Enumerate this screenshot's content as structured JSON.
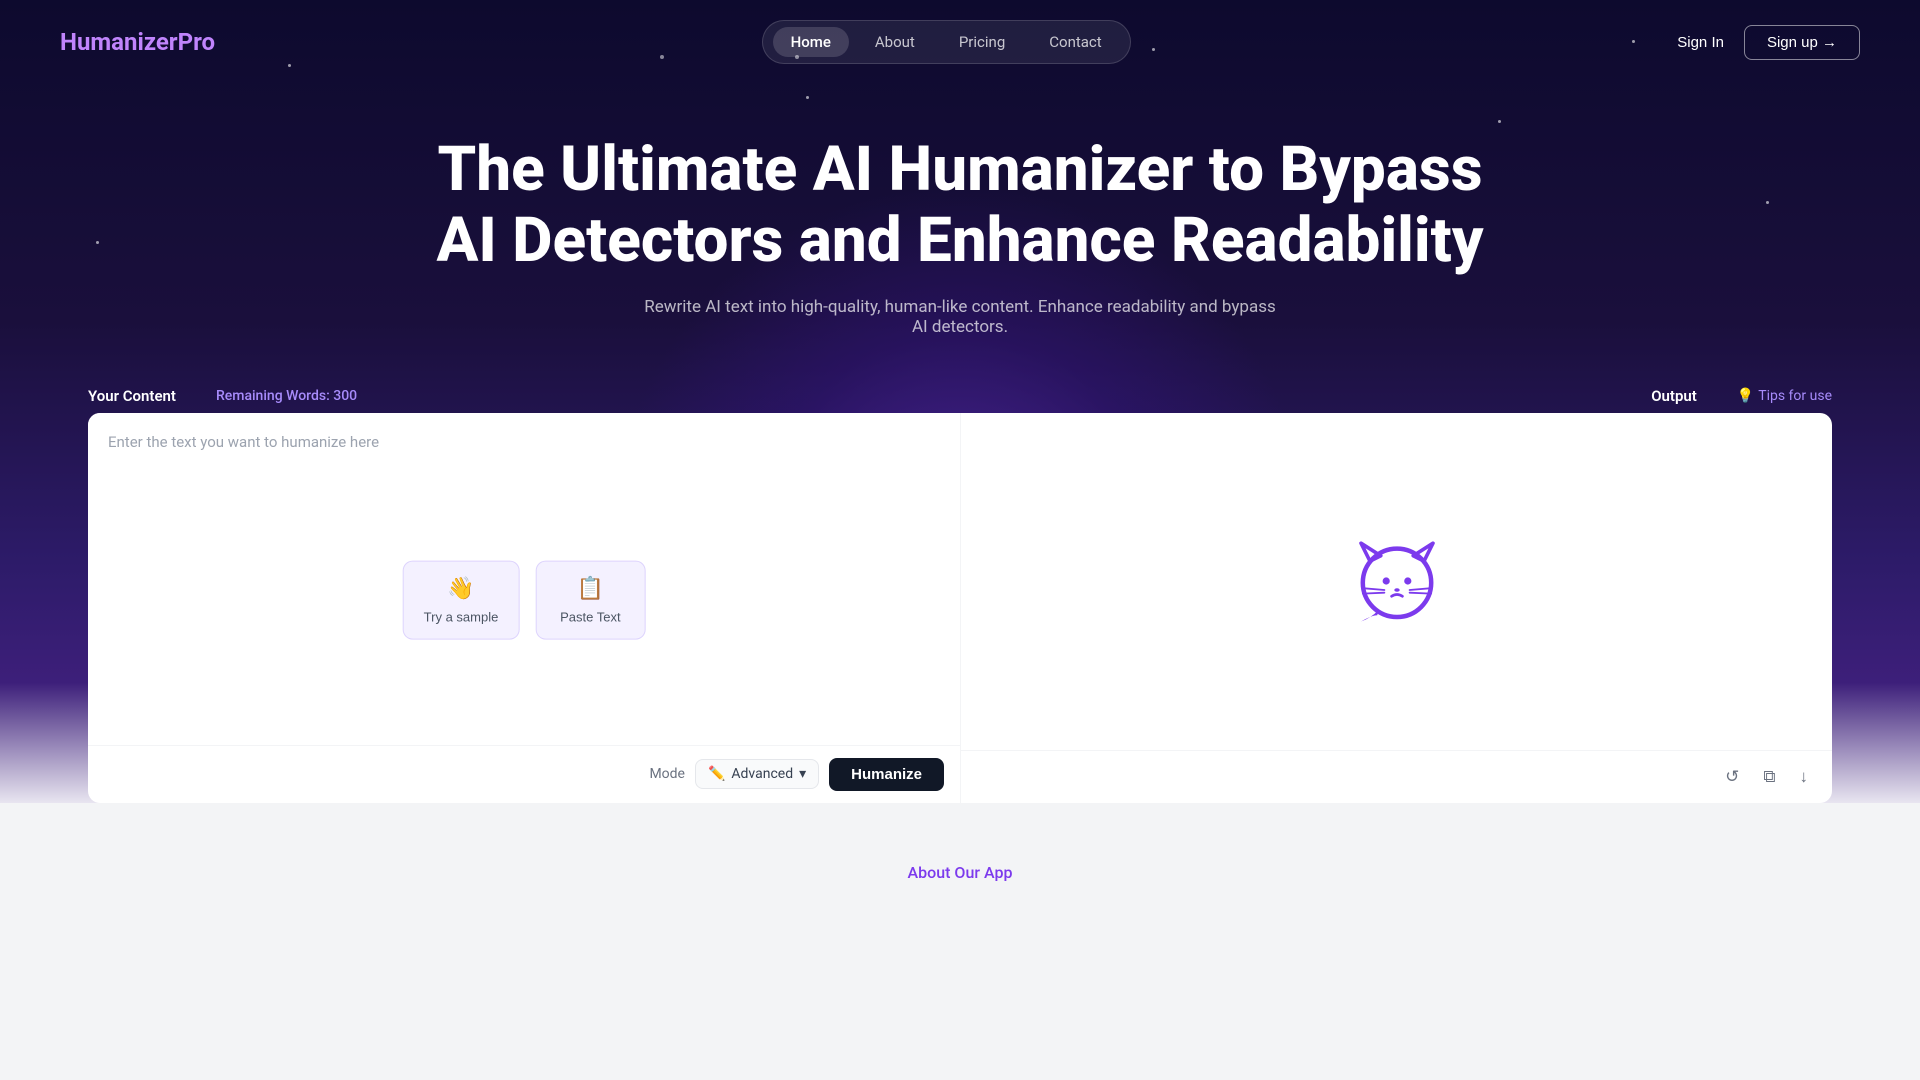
{
  "brand": {
    "name_black": "Humanizer",
    "name_purple": "Pro"
  },
  "nav": {
    "links": [
      {
        "label": "Home",
        "active": true
      },
      {
        "label": "About",
        "active": false
      },
      {
        "label": "Pricing",
        "active": false
      },
      {
        "label": "Contact",
        "active": false
      }
    ],
    "sign_in": "Sign In",
    "sign_up": "Sign up →"
  },
  "hero": {
    "title_line1": "The Ultimate AI Humanizer to Bypass",
    "title_line2": "AI Detectors and Enhance Readability",
    "subtitle": "Rewrite AI text into high-quality, human-like content. Enhance readability and bypass AI detectors."
  },
  "editor": {
    "input_label": "Your Content",
    "remaining_label": "Remaining Words: 300",
    "output_label": "Output",
    "tips_label": "Tips for use",
    "placeholder": "Enter the text you want to humanize here",
    "try_sample_label": "Try a sample",
    "paste_text_label": "Paste Text",
    "mode_label": "Mode",
    "mode_value": "Advanced",
    "humanize_label": "Humanize"
  },
  "about": {
    "label": "About Our App"
  },
  "icons": {
    "tips": "💡",
    "try_sample": "👋",
    "paste": "📋",
    "mode_pen": "✏️",
    "refresh": "↺",
    "copy": "⧉",
    "download": "↓"
  }
}
